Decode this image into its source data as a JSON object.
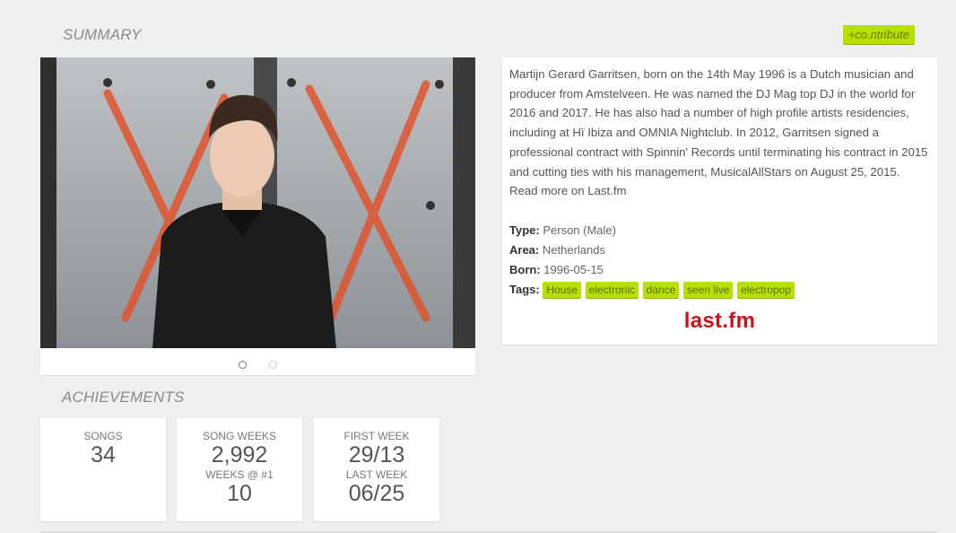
{
  "summary": {
    "title": "SUMMARY",
    "contribute_label": "+co.ntribute"
  },
  "bio": {
    "text": "Martijn Gerard Garritsen, born on the 14th May 1996 is a Dutch musician and producer from Amstelveen. He was named the DJ Mag top DJ in the world for 2016 and 2017. He has also had a number of high profile artists residencies, including at Hï Ibiza and OMNIA Nightclub. In 2012, Garritsen signed a professional contract with Spinnin' Records until terminating his contract in 2015 and cutting ties with his management, MusicalAllStars on August 25, 2015. Read more on Last.fm",
    "type_label": "Type:",
    "type_value": "Person (Male)",
    "area_label": "Area:",
    "area_value": "Netherlands",
    "born_label": "Born:",
    "born_value": "1996-05-15",
    "tags_label": "Tags:",
    "tags": [
      "House",
      "electronic",
      "dance",
      "seen live",
      "electropop"
    ],
    "source_logo": "last.fm"
  },
  "carousel": {
    "dots": 2,
    "active_index": 0
  },
  "achievements": {
    "title": "ACHIEVEMENTS",
    "songs_label": "SONGS",
    "songs_value": "34",
    "song_weeks_label": "SONG WEEKS",
    "song_weeks_value": "2,992",
    "weeks_at_1_label": "WEEKS @ #1",
    "weeks_at_1_value": "10",
    "first_week_label": "FIRST WEEK",
    "first_week_value": "29/13",
    "last_week_label": "LAST WEEK",
    "last_week_value": "06/25"
  },
  "colors": {
    "accent": "#b6e000",
    "lastfm": "#c3151a",
    "background": "#efefef"
  }
}
